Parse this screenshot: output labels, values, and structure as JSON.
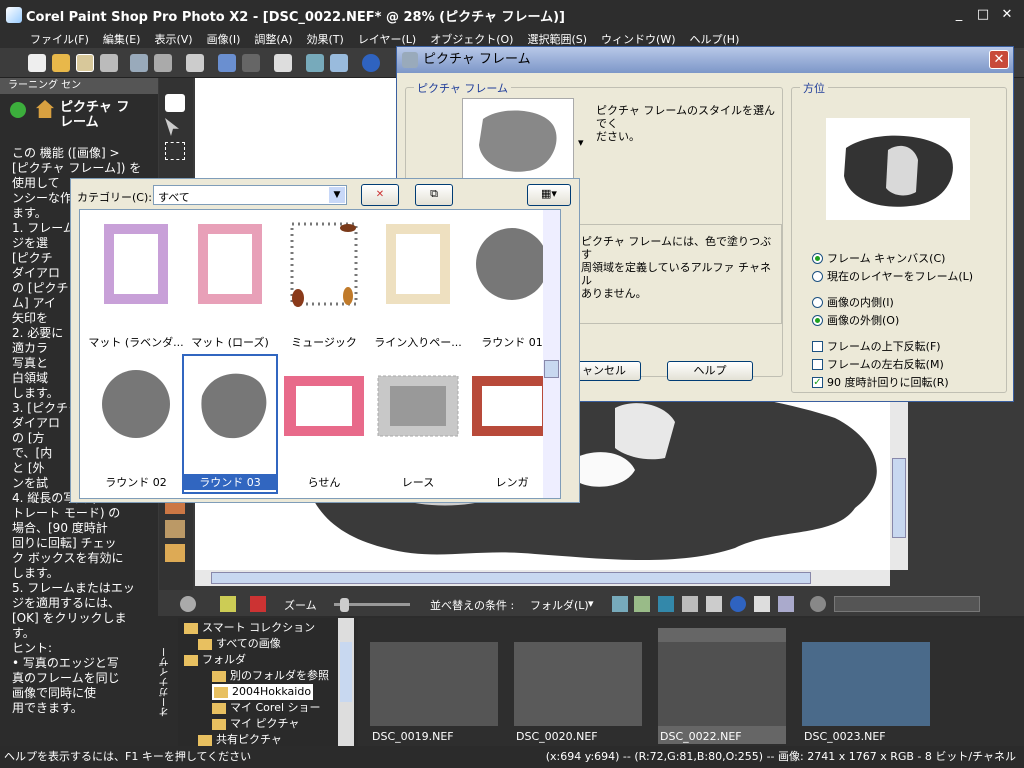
{
  "window": {
    "title": "Corel Paint Shop Pro Photo X2 - [DSC_0022.NEF* @ 28% (ピクチャ フレーム)]"
  },
  "menu": [
    "ファイル(F)",
    "編集(E)",
    "表示(V)",
    "画像(I)",
    "調整(A)",
    "効果(T)",
    "レイヤー(L)",
    "オブジェクト(O)",
    "選択範囲(S)",
    "ウィンドウ(W)",
    "ヘルプ(H)"
  ],
  "learning": {
    "header": "ラーニング セン",
    "title": "ピクチャ フ\nレーム",
    "body": "この 機能 ([画像] >\n[ピクチャ フレーム]) を\n使用して\nンシーな作\nます。\n1. フレーム\nジを選\n[ピクチ\nダイアロ\nの [ピクチ\nム] アイ\n矢印を\n2. 必要に\n適カラ\n写真と\n白領域\nします。\n3. [ピクチャ\nダイアロ\nの [方\nで、[内\nと [外\nンを試\n4. 縦長の写真 (ポー\nトレート モード) の\n場合、[90 度時計\n回りに回転] チェッ\nク ボックスを有効に\nします。\n5. フレームまたはエッ\nジを適用するには、\n[OK] をクリックしま\nす。\nヒント:\n• 写真のエッジと写\n真のフレームを同じ\n画像で同時に使\n用できます。"
  },
  "dialog": {
    "title": "ピクチャ フレーム",
    "frame_group": "ピクチャ フレーム",
    "style_hint": "ピクチャ フレームのスタイルを選んでく\nださい。",
    "note": "ピクチャ フレームには、色で塗りつぶす\n周領域を定義しているアルファ チャネル\nありません。",
    "orientation_group": "方位",
    "radio_canvas": "フレーム キャンバス(C)",
    "radio_layer": "現在のレイヤーをフレーム(L)",
    "radio_inside": "画像の内側(I)",
    "radio_outside": "画像の外側(O)",
    "check_flip_v": "フレームの上下反転(F)",
    "check_flip_h": "フレームの左右反転(M)",
    "check_rotate": "90 度時計回りに回転(R)",
    "cancel": "ャンセル",
    "help": "ヘルプ",
    "state": {
      "canvas": true,
      "layer": false,
      "inside": false,
      "outside": true,
      "flip_v": false,
      "flip_h": false,
      "rotate": true
    }
  },
  "popup": {
    "category_label": "カテゴリー(C):",
    "category_value": "すべて",
    "items": [
      {
        "label": "マット (ラベンダ...",
        "kind": "lavender"
      },
      {
        "label": "マット (ローズ)",
        "kind": "rose"
      },
      {
        "label": "ミュージック",
        "kind": "music"
      },
      {
        "label": "ライン入りペー...",
        "kind": "paper"
      },
      {
        "label": "ラウンド 01",
        "kind": "round1"
      },
      {
        "label": "ラウンド 02",
        "kind": "round2"
      },
      {
        "label": "ラウンド 03",
        "kind": "round3",
        "selected": true
      },
      {
        "label": "らせん",
        "kind": "spiral"
      },
      {
        "label": "レース",
        "kind": "lace"
      },
      {
        "label": "レンガ",
        "kind": "brick"
      }
    ]
  },
  "organizer": {
    "zoom_label": "ズーム",
    "sort_label": "並べ替えの条件 :",
    "sort_value": "フォルダ(L)",
    "side_label": "オーガナイザー",
    "tree": [
      {
        "label": "スマート コレクション",
        "indent": 0
      },
      {
        "label": "すべての画像",
        "indent": 1
      },
      {
        "label": "フォルダ",
        "indent": 0
      },
      {
        "label": "別のフォルダを参照",
        "indent": 2
      },
      {
        "label": "2004Hokkaido",
        "indent": 2
      },
      {
        "label": "マイ Corel ショー",
        "indent": 2
      },
      {
        "label": "マイ ピクチャ",
        "indent": 2
      },
      {
        "label": "共有ピクチャ",
        "indent": 1
      }
    ],
    "thumbs": [
      {
        "label": "DSC_0019.NEF"
      },
      {
        "label": "DSC_0020.NEF"
      },
      {
        "label": "DSC_0022.NEF",
        "selected": true
      },
      {
        "label": "DSC_0023.NEF"
      }
    ]
  },
  "status": {
    "left": "ヘルプを表示するには、F1 キーを押してください",
    "right": "(x:694 y:694) -- (R:72,G:81,B:80,O:255) -- 画像:  2741 x 1767 x RGB - 8 ビット/チャネル"
  }
}
